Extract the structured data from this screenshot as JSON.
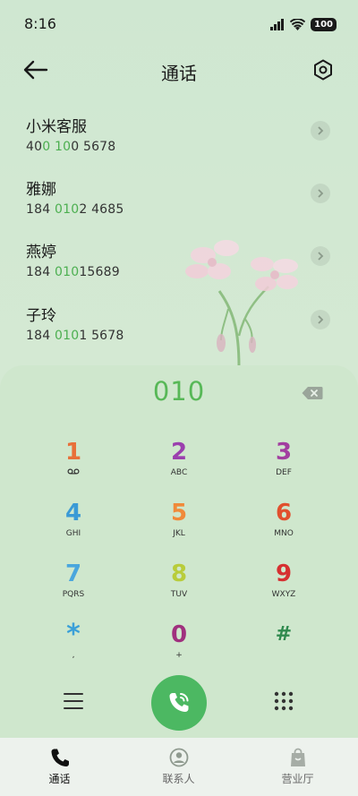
{
  "status": {
    "time": "8:16",
    "battery": "100"
  },
  "header": {
    "title": "通话"
  },
  "contacts": [
    {
      "name": "小米客服",
      "number_parts": [
        "40",
        "0",
        " ",
        "10",
        "0 5678"
      ]
    },
    {
      "name": "雅娜",
      "number_parts": [
        "184 ",
        "010",
        "2 4685"
      ]
    },
    {
      "name": "燕婷",
      "number_parts": [
        "184 ",
        "010",
        "15689"
      ]
    },
    {
      "name": "子玲",
      "number_parts": [
        "184 ",
        "010",
        "1 5678"
      ]
    }
  ],
  "dialer": {
    "input": "010",
    "keys": [
      {
        "digit": "1",
        "sub": "voicemail-icon",
        "color": "#e8703a"
      },
      {
        "digit": "2",
        "sub": "ABC",
        "color": "#9b3fae"
      },
      {
        "digit": "3",
        "sub": "DEF",
        "color": "#a23ea0"
      },
      {
        "digit": "4",
        "sub": "GHI",
        "color": "#3b9ad6"
      },
      {
        "digit": "5",
        "sub": "JKL",
        "color": "#f08a3a"
      },
      {
        "digit": "6",
        "sub": "MNO",
        "color": "#e1502e"
      },
      {
        "digit": "7",
        "sub": "PQRS",
        "color": "#4aa6dd"
      },
      {
        "digit": "8",
        "sub": "TUV",
        "color": "#b8cc3a"
      },
      {
        "digit": "9",
        "sub": "WXYZ",
        "color": "#d63031"
      },
      {
        "digit": "*",
        "sub": ",",
        "color": "#3ba0d8"
      },
      {
        "digit": "0",
        "sub": "+",
        "color": "#a0307e"
      },
      {
        "digit": "#",
        "sub": "",
        "color": "#2f8a4e"
      }
    ]
  },
  "bottom_nav": [
    {
      "label": "通话",
      "icon": "phone-icon",
      "active": true
    },
    {
      "label": "联系人",
      "icon": "contact-icon",
      "active": false
    },
    {
      "label": "营业厅",
      "icon": "bag-icon",
      "active": false
    }
  ],
  "colors": {
    "accent": "#4cb862",
    "highlight": "#4caf50"
  }
}
